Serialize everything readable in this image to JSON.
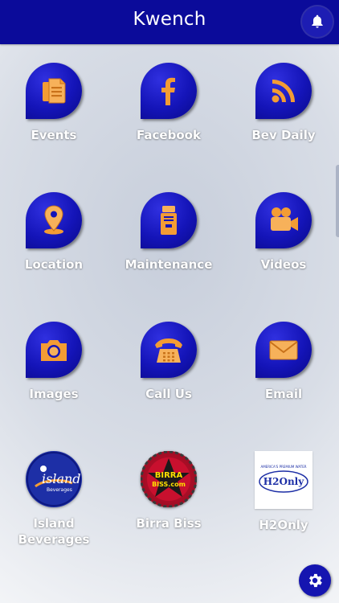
{
  "app": {
    "title": "Kwench"
  },
  "colors": {
    "header": "#0b0b9a",
    "icon_blue": "#1414b8",
    "glyph_orange": "#f39c34"
  },
  "tiles": [
    {
      "label": "Events",
      "icon": "document-icon"
    },
    {
      "label": "Facebook",
      "icon": "facebook-icon"
    },
    {
      "label": "Bev Daily",
      "icon": "rss-icon"
    },
    {
      "label": "Location",
      "icon": "map-pin-icon"
    },
    {
      "label": "Maintenance",
      "icon": "water-cooler-icon"
    },
    {
      "label": "Videos",
      "icon": "video-camera-icon"
    },
    {
      "label": "Images",
      "icon": "camera-icon"
    },
    {
      "label": "Call Us",
      "icon": "telephone-icon"
    },
    {
      "label": "Email",
      "icon": "envelope-icon"
    }
  ],
  "logos": [
    {
      "label": "Island\nBeverages",
      "mark": "island",
      "mark_small": "Beverages"
    },
    {
      "label": "Birra Biss",
      "mark": "BIRRA",
      "mark2": "BISS.com"
    },
    {
      "label": "H2Only",
      "mark": "H2Only",
      "mark_top": "AMERICA'S PREMIUM WATER"
    }
  ]
}
